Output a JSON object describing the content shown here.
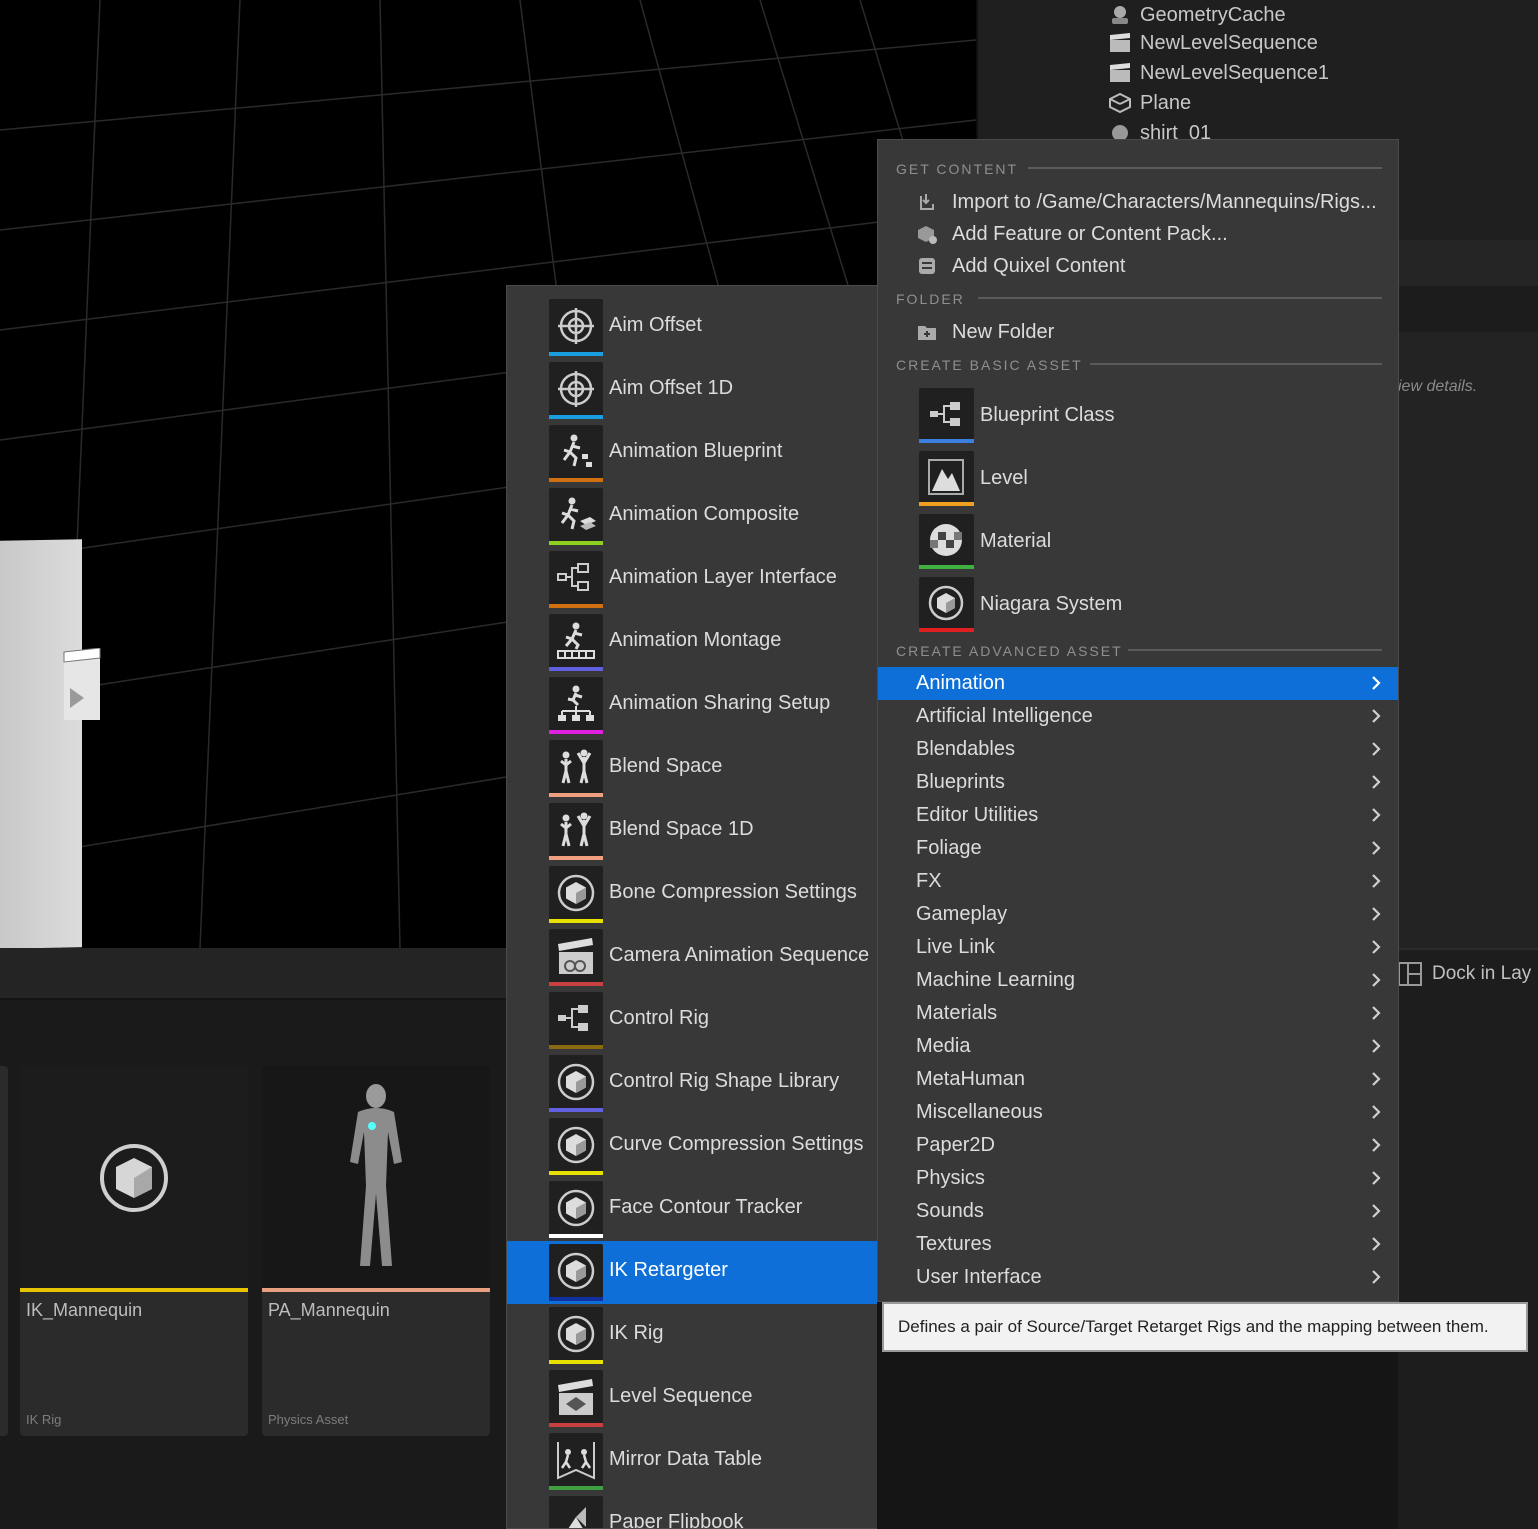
{
  "outliner": {
    "items": [
      {
        "label": "GeometryCache",
        "icon": "geometry-cache-icon"
      },
      {
        "label": "NewLevelSequence",
        "icon": "clapperboard-icon"
      },
      {
        "label": "NewLevelSequence1",
        "icon": "clapperboard-icon"
      },
      {
        "label": "Plane",
        "icon": "static-mesh-icon"
      },
      {
        "label": "shirt_01",
        "icon": "sphere-icon"
      }
    ]
  },
  "details": {
    "hint": "iew details."
  },
  "content_browser": {
    "tiles": [
      {
        "name": "IK_Mannequin",
        "type": "IK Rig",
        "color": "#e8c400"
      },
      {
        "name": "PA_Mannequin",
        "type": "Physics Asset",
        "color": "#e8a080"
      }
    ]
  },
  "dock": {
    "label": "Dock in Lay"
  },
  "menu": {
    "get_content": {
      "header": "GET CONTENT",
      "items": [
        {
          "label": "Import to /Game/Characters/Mannequins/Rigs...",
          "icon": "import-icon"
        },
        {
          "label": "Add Feature or Content Pack...",
          "icon": "content-pack-icon"
        },
        {
          "label": "Add Quixel Content",
          "icon": "quixel-icon"
        }
      ]
    },
    "folder": {
      "header": "FOLDER",
      "items": [
        {
          "label": "New Folder",
          "icon": "new-folder-icon"
        }
      ]
    },
    "basic": {
      "header": "CREATE BASIC ASSET",
      "items": [
        {
          "label": "Blueprint Class",
          "icon": "blueprint-icon",
          "color": "#3b7fe0"
        },
        {
          "label": "Level",
          "icon": "level-icon",
          "color": "#f0a020"
        },
        {
          "label": "Material",
          "icon": "material-icon",
          "color": "#40b040"
        },
        {
          "label": "Niagara System",
          "icon": "niagara-icon",
          "color": "#e02020"
        }
      ]
    },
    "advanced": {
      "header": "CREATE ADVANCED ASSET",
      "items": [
        "Animation",
        "Artificial Intelligence",
        "Blendables",
        "Blueprints",
        "Editor Utilities",
        "Foliage",
        "FX",
        "Gameplay",
        "Live Link",
        "Machine Learning",
        "Materials",
        "Media",
        "MetaHuman",
        "Miscellaneous",
        "Paper2D",
        "Physics",
        "Sounds",
        "Textures",
        "User Interface"
      ],
      "active": "Animation"
    }
  },
  "animation_submenu": {
    "items": [
      {
        "label": "Aim Offset",
        "icon": "aim-offset-icon",
        "color": "#1a9ee0"
      },
      {
        "label": "Aim Offset 1D",
        "icon": "aim-offset-icon",
        "color": "#1a9ee0"
      },
      {
        "label": "Animation Blueprint",
        "icon": "anim-blueprint-icon",
        "color": "#d07010"
      },
      {
        "label": "Animation Composite",
        "icon": "anim-composite-icon",
        "color": "#90d020"
      },
      {
        "label": "Animation Layer Interface",
        "icon": "anim-layer-icon",
        "color": "#d07010"
      },
      {
        "label": "Animation Montage",
        "icon": "anim-montage-icon",
        "color": "#6060e0"
      },
      {
        "label": "Animation Sharing Setup",
        "icon": "anim-sharing-icon",
        "color": "#e020e0"
      },
      {
        "label": "Blend Space",
        "icon": "blend-space-icon",
        "color": "#f0a080"
      },
      {
        "label": "Blend Space 1D",
        "icon": "blend-space-icon",
        "color": "#f0a080"
      },
      {
        "label": "Bone Compression Settings",
        "icon": "cube-icon",
        "color": "#e8e000"
      },
      {
        "label": "Camera Animation Sequence",
        "icon": "camera-sequence-icon",
        "color": "#c84040"
      },
      {
        "label": "Control Rig",
        "icon": "control-rig-icon",
        "color": "#8a6a10"
      },
      {
        "label": "Control Rig Shape Library",
        "icon": "cube-icon",
        "color": "#6060e0"
      },
      {
        "label": "Curve Compression Settings",
        "icon": "cube-icon",
        "color": "#e8e000"
      },
      {
        "label": "Face Contour Tracker",
        "icon": "cube-icon",
        "color": "#ffffff"
      },
      {
        "label": "IK Retargeter",
        "icon": "cube-icon",
        "color": "#1030a0"
      },
      {
        "label": "IK Rig",
        "icon": "cube-icon",
        "color": "#e8e000"
      },
      {
        "label": "Level Sequence",
        "icon": "level-sequence-icon",
        "color": "#c84040"
      },
      {
        "label": "Mirror Data Table",
        "icon": "mirror-table-icon",
        "color": "#40a040"
      },
      {
        "label": "Paper Flipbook",
        "icon": "flipbook-icon",
        "color": "#e0a000"
      }
    ],
    "active": "IK Retargeter"
  },
  "tooltip": {
    "text": "Defines a pair of Source/Target Retarget Rigs and the mapping between them."
  }
}
